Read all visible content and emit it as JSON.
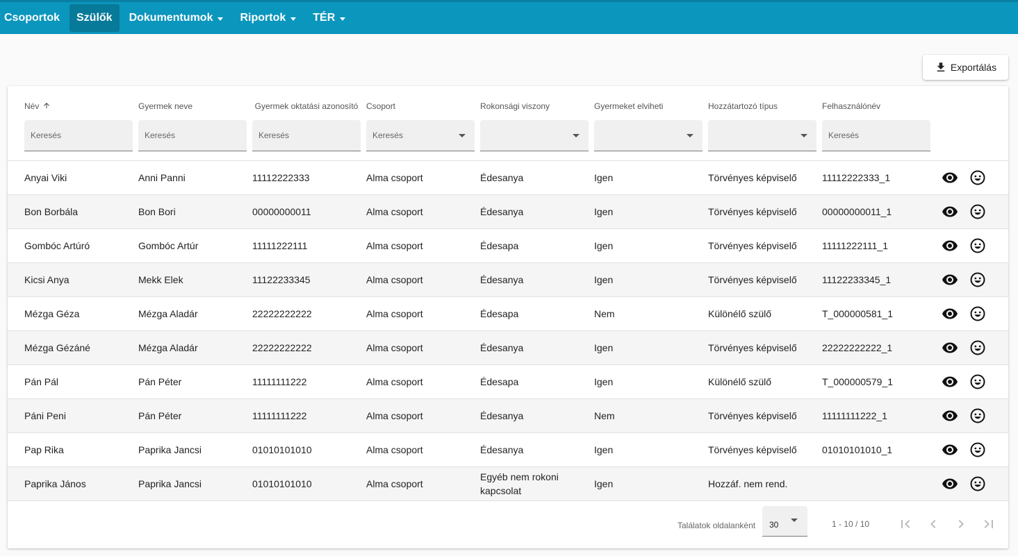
{
  "nav": {
    "items": [
      {
        "label": "Csoportok",
        "dropdown": false,
        "active": false
      },
      {
        "label": "Szülők",
        "dropdown": false,
        "active": true
      },
      {
        "label": "Dokumentumok",
        "dropdown": true,
        "active": false
      },
      {
        "label": "Riportok",
        "dropdown": true,
        "active": false
      },
      {
        "label": "TÉR",
        "dropdown": true,
        "active": false
      }
    ]
  },
  "toolbar": {
    "export_label": "Exportálás",
    "export_icon": "download-icon"
  },
  "columns": [
    {
      "label": "Név",
      "filter": "text",
      "placeholder": "Keresés",
      "sorted": "asc"
    },
    {
      "label": "Gyermek neve",
      "filter": "text",
      "placeholder": "Keresés"
    },
    {
      "label": "Gyermek oktatási azonosító",
      "filter": "text",
      "placeholder": "Keresés"
    },
    {
      "label": "Csoport",
      "filter": "select",
      "placeholder": "Keresés"
    },
    {
      "label": "Rokonsági viszony",
      "filter": "select",
      "placeholder": ""
    },
    {
      "label": "Gyermeket elviheti",
      "filter": "select",
      "placeholder": ""
    },
    {
      "label": "Hozzátartozó típus",
      "filter": "select",
      "placeholder": ""
    },
    {
      "label": "Felhasználónév",
      "filter": "text",
      "placeholder": "Keresés"
    }
  ],
  "rows": [
    [
      "Anyai Viki",
      "Anni Panni",
      "11112222333",
      "Alma csoport",
      "Édesanya",
      "Igen",
      "Törvényes képviselő",
      "11112222333_1"
    ],
    [
      "Bon Borbála",
      "Bon Bori",
      "00000000011",
      "Alma csoport",
      "Édesanya",
      "Igen",
      "Törvényes képviselő",
      "00000000011_1"
    ],
    [
      "Gombóc Artúró",
      "Gombóc Artúr",
      "11111222111",
      "Alma csoport",
      "Édesapa",
      "Igen",
      "Törvényes képviselő",
      "11111222111_1"
    ],
    [
      "Kicsi Anya",
      "Mekk Elek",
      "11122233345",
      "Alma csoport",
      "Édesanya",
      "Igen",
      "Törvényes képviselő",
      "11122233345_1"
    ],
    [
      "Mézga Géza",
      "Mézga Aladár",
      "22222222222",
      "Alma csoport",
      "Édesapa",
      "Nem",
      "Különélő szülő",
      "T_000000581_1"
    ],
    [
      "Mézga Gézáné",
      "Mézga Aladár",
      "22222222222",
      "Alma csoport",
      "Édesanya",
      "Igen",
      "Törvényes képviselő",
      "22222222222_1"
    ],
    [
      "Pán Pál",
      "Pán Péter",
      "11111111222",
      "Alma csoport",
      "Édesapa",
      "Igen",
      "Különélő szülő",
      "T_000000579_1"
    ],
    [
      "Páni Peni",
      "Pán Péter",
      "11111111222",
      "Alma csoport",
      "Édesanya",
      "Nem",
      "Törvényes képviselő",
      "11111111222_1"
    ],
    [
      "Pap Rika",
      "Paprika Jancsi",
      "01010101010",
      "Alma csoport",
      "Édesanya",
      "Igen",
      "Törvényes képviselő",
      "01010101010_1"
    ],
    [
      "Paprika János",
      "Paprika Jancsi",
      "01010101010",
      "Alma csoport",
      "Egyéb nem rokoni kapcsolat",
      "Igen",
      "Hozzáf. nem rend.",
      ""
    ]
  ],
  "row_actions": [
    "eye-icon",
    "face-icon"
  ],
  "pagination": {
    "per_page_label": "Találatok oldalanként",
    "per_page_value": "30",
    "range": "1 - 10 / 10",
    "icons": [
      "first-page-icon",
      "prev-page-icon",
      "next-page-icon",
      "last-page-icon"
    ]
  }
}
